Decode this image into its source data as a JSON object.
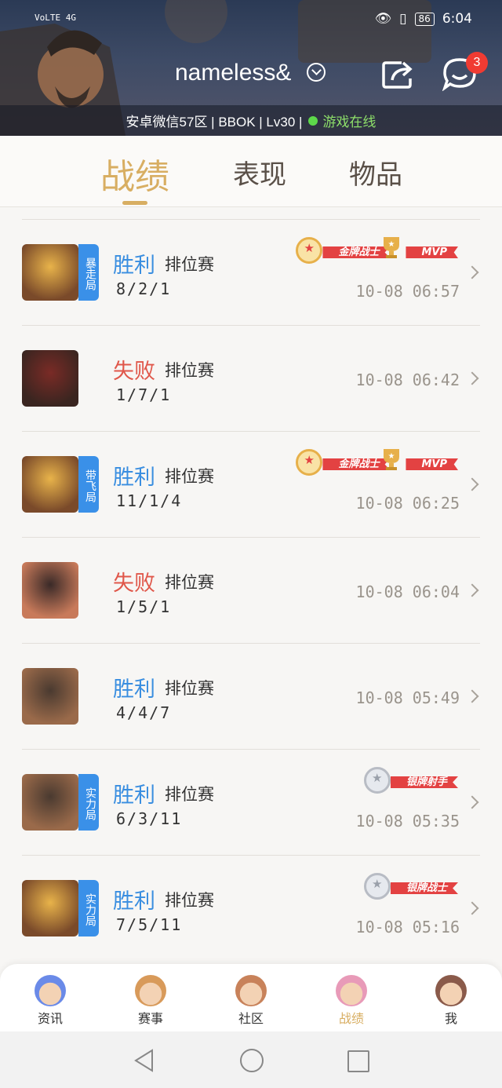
{
  "status_bar": {
    "left_text": "VoLTE 4G",
    "battery": "86",
    "time": "6:04"
  },
  "header": {
    "username": "nameless&",
    "message_badge": "3",
    "info_text": "安卓微信57区 | BBOK | Lv30 |",
    "online_text": "游戏在线"
  },
  "tabs": [
    {
      "label": "战绩",
      "active": true
    },
    {
      "label": "表现",
      "active": false
    },
    {
      "label": "物品",
      "active": false
    }
  ],
  "matches": [
    {
      "tag": "暴走局",
      "result": "胜利",
      "outcome": "win",
      "mode": "排位赛",
      "kda": "8/2/1",
      "time": "10-08 06:57",
      "badges": [
        "金牌战士",
        "MVP"
      ]
    },
    {
      "tag": "",
      "result": "失败",
      "outcome": "loss",
      "mode": "排位赛",
      "kda": "1/7/1",
      "time": "10-08 06:42",
      "badges": []
    },
    {
      "tag": "带飞局",
      "result": "胜利",
      "outcome": "win",
      "mode": "排位赛",
      "kda": "11/1/4",
      "time": "10-08 06:25",
      "badges": [
        "金牌战士",
        "MVP"
      ]
    },
    {
      "tag": "",
      "result": "失败",
      "outcome": "loss",
      "mode": "排位赛",
      "kda": "1/5/1",
      "time": "10-08 06:04",
      "badges": []
    },
    {
      "tag": "",
      "result": "胜利",
      "outcome": "win",
      "mode": "排位赛",
      "kda": "4/4/7",
      "time": "10-08 05:49",
      "badges": []
    },
    {
      "tag": "实力局",
      "result": "胜利",
      "outcome": "win",
      "mode": "排位赛",
      "kda": "6/3/11",
      "time": "10-08 05:35",
      "badges": [
        "银牌射手"
      ]
    },
    {
      "tag": "实力局",
      "result": "胜利",
      "outcome": "win",
      "mode": "排位赛",
      "kda": "7/5/11",
      "time": "10-08 05:16",
      "badges": [
        "银牌战士"
      ]
    }
  ],
  "bottom_nav": [
    {
      "label": "资讯",
      "icon": "news-avatar-icon"
    },
    {
      "label": "赛事",
      "icon": "events-avatar-icon"
    },
    {
      "label": "社区",
      "icon": "community-avatar-icon"
    },
    {
      "label": "战绩",
      "icon": "record-avatar-icon",
      "active": true
    },
    {
      "label": "我",
      "icon": "me-avatar-icon"
    }
  ],
  "colors": {
    "accent_gold": "#d8ae62",
    "win_blue": "#3a8ee0",
    "loss_red": "#e0574a",
    "badge_red": "#e34242",
    "tag_blue": "#3a90e8"
  }
}
